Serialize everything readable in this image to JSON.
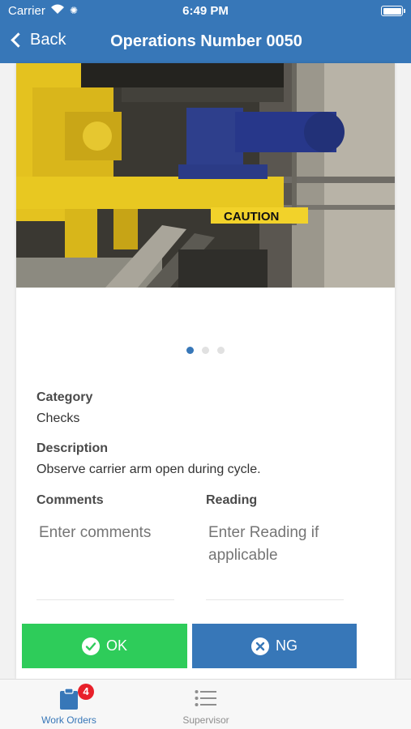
{
  "status_bar": {
    "carrier": "Carrier",
    "time": "6:49 PM"
  },
  "nav": {
    "back_label": "Back",
    "title": "Operations Number 0050"
  },
  "photo": {
    "caption_text": "CAUTION",
    "page_count": 3,
    "active_page": 1
  },
  "details": {
    "category_label": "Category",
    "category_value": "Checks",
    "description_label": "Description",
    "description_value": "Observe carrier arm open during cycle.",
    "comments_label": "Comments",
    "comments_placeholder": "Enter comments",
    "reading_label": "Reading",
    "reading_placeholder": "Enter Reading if applicable"
  },
  "actions": {
    "ok_label": "OK",
    "ng_label": "NG",
    "ok_color": "#2ecc5a",
    "ng_color": "#3777b8"
  },
  "tabbar": {
    "items": [
      {
        "label": "Work Orders",
        "icon": "clipboard-icon",
        "badge": "4",
        "active": true
      },
      {
        "label": "Supervisor",
        "icon": "list-icon",
        "active": false
      }
    ]
  },
  "colors": {
    "brand": "#3777b8",
    "badge": "#e8202a"
  }
}
